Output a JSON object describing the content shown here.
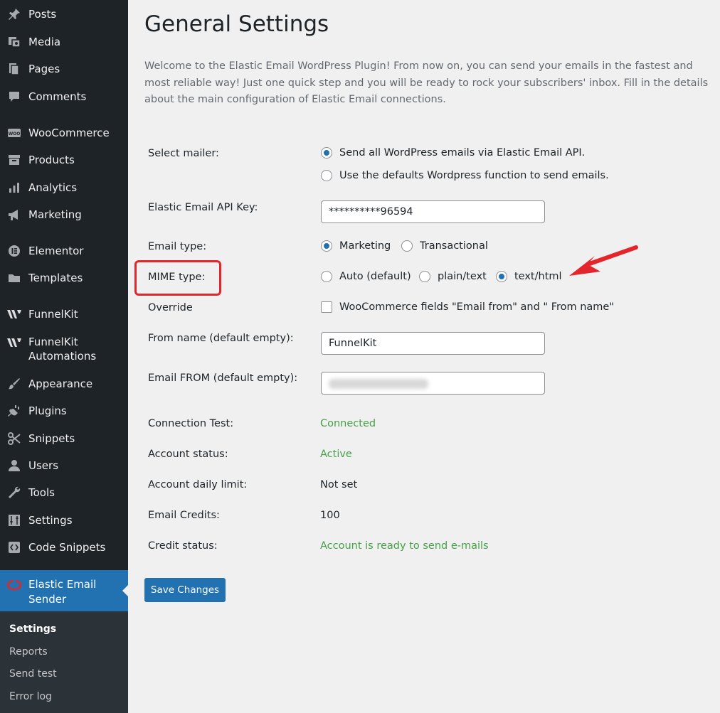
{
  "sidebar": {
    "items": [
      {
        "label": "Posts",
        "icon": "pin-icon"
      },
      {
        "label": "Media",
        "icon": "media-icon"
      },
      {
        "label": "Pages",
        "icon": "pages-icon"
      },
      {
        "label": "Comments",
        "icon": "comments-icon"
      },
      {
        "label": "WooCommerce",
        "icon": "woo-icon"
      },
      {
        "label": "Products",
        "icon": "products-icon"
      },
      {
        "label": "Analytics",
        "icon": "analytics-icon"
      },
      {
        "label": "Marketing",
        "icon": "megaphone-icon"
      },
      {
        "label": "Elementor",
        "icon": "elementor-icon"
      },
      {
        "label": "Templates",
        "icon": "folder-icon"
      },
      {
        "label": "FunnelKit",
        "icon": "funnelkit-icon"
      },
      {
        "label": "FunnelKit",
        "label2": "Automations",
        "icon": "funnelkit-icon"
      },
      {
        "label": "Appearance",
        "icon": "brush-icon"
      },
      {
        "label": "Plugins",
        "icon": "plug-icon"
      },
      {
        "label": "Snippets",
        "icon": "scissors-icon"
      },
      {
        "label": "Users",
        "icon": "user-icon"
      },
      {
        "label": "Tools",
        "icon": "wrench-icon"
      },
      {
        "label": "Settings",
        "icon": "sliders-icon"
      },
      {
        "label": "Code Snippets",
        "icon": "code-icon"
      }
    ],
    "active": {
      "label": "Elastic Email",
      "label2": "Sender",
      "icon": "elastic-email-icon"
    },
    "submenu": [
      "Settings",
      "Reports",
      "Send test",
      "Error log"
    ]
  },
  "page": {
    "title": "General Settings",
    "intro": "Welcome to the Elastic Email WordPress Plugin! From now on, you can send your emails in the fastest and most reliable way! Just one quick step and you will be ready to rock your subscribers' inbox. Fill in the details about the main configuration of Elastic Email connections."
  },
  "form": {
    "select_mailer": {
      "label": "Select mailer:",
      "options": [
        "Send all WordPress emails via Elastic Email API.",
        "Use the defaults Wordpress function to send emails."
      ],
      "selected": 0
    },
    "api_key": {
      "label": "Elastic Email API Key:",
      "value": "**********96594"
    },
    "email_type": {
      "label": "Email type:",
      "options": [
        "Marketing",
        "Transactional"
      ],
      "selected": 0
    },
    "mime_type": {
      "label": "MIME type:",
      "options": [
        "Auto (default)",
        "plain/text",
        "text/html"
      ],
      "selected": 2
    },
    "override": {
      "label": "Override",
      "checkbox_label": "WooCommerce fields \"Email from\" and \" From name\"",
      "checked": false
    },
    "from_name": {
      "label": "From name (default empty):",
      "value": "FunnelKit"
    },
    "email_from": {
      "label": "Email FROM (default empty):",
      "value": ""
    }
  },
  "status": {
    "connection_test": {
      "label": "Connection Test:",
      "value": "Connected"
    },
    "account_status": {
      "label": "Account status:",
      "value": "Active"
    },
    "daily_limit": {
      "label": "Account daily limit:",
      "value": "Not set"
    },
    "email_credits": {
      "label": "Email Credits:",
      "value": "100"
    },
    "credit_status": {
      "label": "Credit status:",
      "value": "Account is ready to send e-mails"
    }
  },
  "save_label": "Save Changes",
  "colors": {
    "accent": "#2271b1",
    "sidebar": "#1d2327",
    "success": "#46a046",
    "annotation": "#e3262b"
  }
}
